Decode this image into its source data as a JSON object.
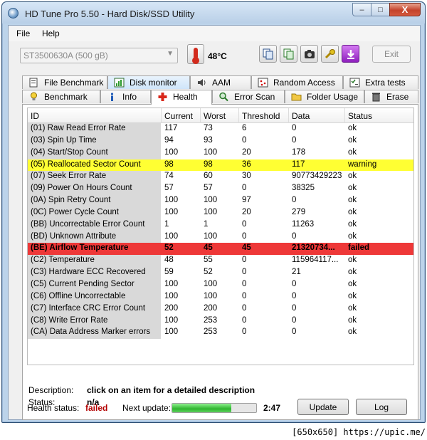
{
  "window": {
    "title": "HD Tune Pro 5.50 - Hard Disk/SSD Utility",
    "buttons": {
      "minimize": "–",
      "maximize": "□",
      "close": "X"
    }
  },
  "menu": {
    "file": "File",
    "help": "Help"
  },
  "toolbar": {
    "drive": "ST3500630A (500 gB)",
    "temperature": "48°C",
    "exit": "Exit",
    "icons": [
      "copy-icon",
      "copy-all-icon",
      "screenshot-camera-icon",
      "options-wrench-icon",
      "save-down-arrow-icon"
    ]
  },
  "tabs_row1": [
    {
      "label": "File Benchmark",
      "icon": "file-icon"
    },
    {
      "label": "Disk monitor",
      "icon": "monitor-chart-icon"
    },
    {
      "label": "AAM",
      "icon": "speaker-icon"
    },
    {
      "label": "Random Access",
      "icon": "grid-dots-icon"
    },
    {
      "label": "Extra tests",
      "icon": "checklist-icon"
    }
  ],
  "tabs_row2": [
    {
      "label": "Benchmark",
      "icon": "bulb-icon"
    },
    {
      "label": "Info",
      "icon": "info-icon"
    },
    {
      "label": "Health",
      "icon": "red-cross-icon"
    },
    {
      "label": "Error Scan",
      "icon": "magnifier-icon"
    },
    {
      "label": "Folder Usage",
      "icon": "folder-icon"
    },
    {
      "label": "Erase",
      "icon": "trash-icon"
    }
  ],
  "active_tab": "Health",
  "columns": {
    "id": "ID",
    "current": "Current",
    "worst": "Worst",
    "threshold": "Threshold",
    "data": "Data",
    "status": "Status"
  },
  "rows": [
    {
      "id": "(01) Raw Read Error Rate",
      "current": "117",
      "worst": "73",
      "threshold": "6",
      "data": "0",
      "status": "ok",
      "level": "normal"
    },
    {
      "id": "(03) Spin Up Time",
      "current": "94",
      "worst": "93",
      "threshold": "0",
      "data": "0",
      "status": "ok",
      "level": "normal"
    },
    {
      "id": "(04) Start/Stop Count",
      "current": "100",
      "worst": "100",
      "threshold": "20",
      "data": "178",
      "status": "ok",
      "level": "normal"
    },
    {
      "id": "(05) Reallocated Sector Count",
      "current": "98",
      "worst": "98",
      "threshold": "36",
      "data": "117",
      "status": "warning",
      "level": "warning"
    },
    {
      "id": "(07) Seek Error Rate",
      "current": "74",
      "worst": "60",
      "threshold": "30",
      "data": "90773429223",
      "status": "ok",
      "level": "normal"
    },
    {
      "id": "(09) Power On Hours Count",
      "current": "57",
      "worst": "57",
      "threshold": "0",
      "data": "38325",
      "status": "ok",
      "level": "normal"
    },
    {
      "id": "(0A) Spin Retry Count",
      "current": "100",
      "worst": "100",
      "threshold": "97",
      "data": "0",
      "status": "ok",
      "level": "normal"
    },
    {
      "id": "(0C) Power Cycle Count",
      "current": "100",
      "worst": "100",
      "threshold": "20",
      "data": "279",
      "status": "ok",
      "level": "normal"
    },
    {
      "id": "(BB) Uncorrectable Error Count",
      "current": "1",
      "worst": "1",
      "threshold": "0",
      "data": "11263",
      "status": "ok",
      "level": "normal"
    },
    {
      "id": "(BD) Unknown Attribute",
      "current": "100",
      "worst": "100",
      "threshold": "0",
      "data": "0",
      "status": "ok",
      "level": "normal"
    },
    {
      "id": "(BE) Airflow Temperature",
      "current": "52",
      "worst": "45",
      "threshold": "45",
      "data": "21320734...",
      "status": "failed",
      "level": "failed"
    },
    {
      "id": "(C2) Temperature",
      "current": "48",
      "worst": "55",
      "threshold": "0",
      "data": "115964117...",
      "status": "ok",
      "level": "normal"
    },
    {
      "id": "(C3) Hardware ECC Recovered",
      "current": "59",
      "worst": "52",
      "threshold": "0",
      "data": "21",
      "status": "ok",
      "level": "normal"
    },
    {
      "id": "(C5) Current Pending Sector",
      "current": "100",
      "worst": "100",
      "threshold": "0",
      "data": "0",
      "status": "ok",
      "level": "normal"
    },
    {
      "id": "(C6) Offline Uncorrectable",
      "current": "100",
      "worst": "100",
      "threshold": "0",
      "data": "0",
      "status": "ok",
      "level": "normal"
    },
    {
      "id": "(C7) Interface CRC Error Count",
      "current": "200",
      "worst": "200",
      "threshold": "0",
      "data": "0",
      "status": "ok",
      "level": "normal"
    },
    {
      "id": "(C8) Write Error Rate",
      "current": "100",
      "worst": "253",
      "threshold": "0",
      "data": "0",
      "status": "ok",
      "level": "normal"
    },
    {
      "id": "(CA) Data Address Marker errors",
      "current": "100",
      "worst": "253",
      "threshold": "0",
      "data": "0",
      "status": "ok",
      "level": "normal"
    }
  ],
  "description": {
    "label": "Description:",
    "value": "click on an item for a detailed description",
    "status_label": "Status:",
    "status_value": "n/a"
  },
  "footer": {
    "health_label": "Health status:",
    "health_value": "failed",
    "next_update_label": "Next update:",
    "progress_fraction": 0.7,
    "countdown": "2:47",
    "update_button": "Update",
    "log_button": "Log"
  },
  "colors": {
    "warning_row": "#ffff33",
    "failed_row": "#ee3838",
    "failed_text": "#b30000"
  },
  "watermark": "[650x650] https://upic.me/"
}
